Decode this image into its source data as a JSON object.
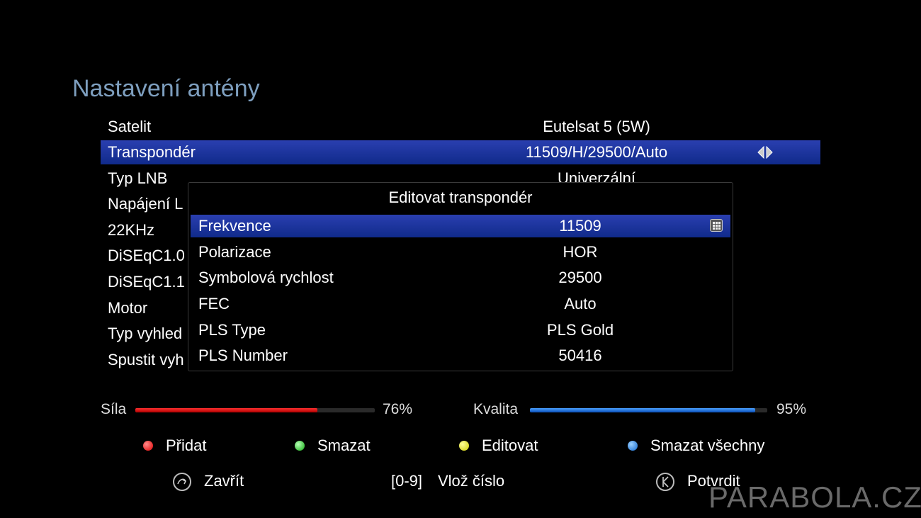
{
  "title": "Nastavení antény",
  "menu": [
    {
      "label": "Satelit",
      "value": "Eutelsat 5 (5W)"
    },
    {
      "label": "Transpondér",
      "value": "11509/H/29500/Auto"
    },
    {
      "label": "Typ LNB",
      "value": "Univerzální"
    },
    {
      "label": "Napájení L",
      "value": ""
    },
    {
      "label": "22KHz",
      "value": ""
    },
    {
      "label": "DiSEqC1.0",
      "value": ""
    },
    {
      "label": "DiSEqC1.1",
      "value": ""
    },
    {
      "label": "Motor",
      "value": ""
    },
    {
      "label": "Typ vyhled",
      "value": ""
    },
    {
      "label": "Spustit vyh",
      "value": ""
    }
  ],
  "dialog": {
    "title": "Editovat transpondér",
    "rows": [
      {
        "label": "Frekvence",
        "value": "11509"
      },
      {
        "label": "Polarizace",
        "value": "HOR"
      },
      {
        "label": "Symbolová rychlost",
        "value": "29500"
      },
      {
        "label": "FEC",
        "value": "Auto"
      },
      {
        "label": "PLS Type",
        "value": "PLS Gold"
      },
      {
        "label": "PLS Number",
        "value": "50416"
      }
    ]
  },
  "signal": {
    "strength_label": "Síla",
    "strength_value": "76%",
    "strength_fraction": 0.76,
    "quality_label": "Kvalita",
    "quality_value": "95%",
    "quality_fraction": 0.95
  },
  "legend": [
    {
      "color": "#e11",
      "label": "Přidat"
    },
    {
      "color": "#3c3",
      "label": "Smazat"
    },
    {
      "color": "#ee2",
      "label": "Editovat"
    },
    {
      "color": "#28f",
      "label": "Smazat všechny"
    }
  ],
  "bottom": {
    "close_label": "Zavřít",
    "numkeys_label": "[0-9]",
    "numkeys_text": "Vlož číslo",
    "ok_label": "Potvrdit"
  },
  "watermark": "PARABOLA.CZ",
  "icons": {
    "exit": "exit-icon",
    "ok": "ok-icon",
    "keypad": "keypad-icon",
    "arrows": "left-right-arrows-icon"
  }
}
